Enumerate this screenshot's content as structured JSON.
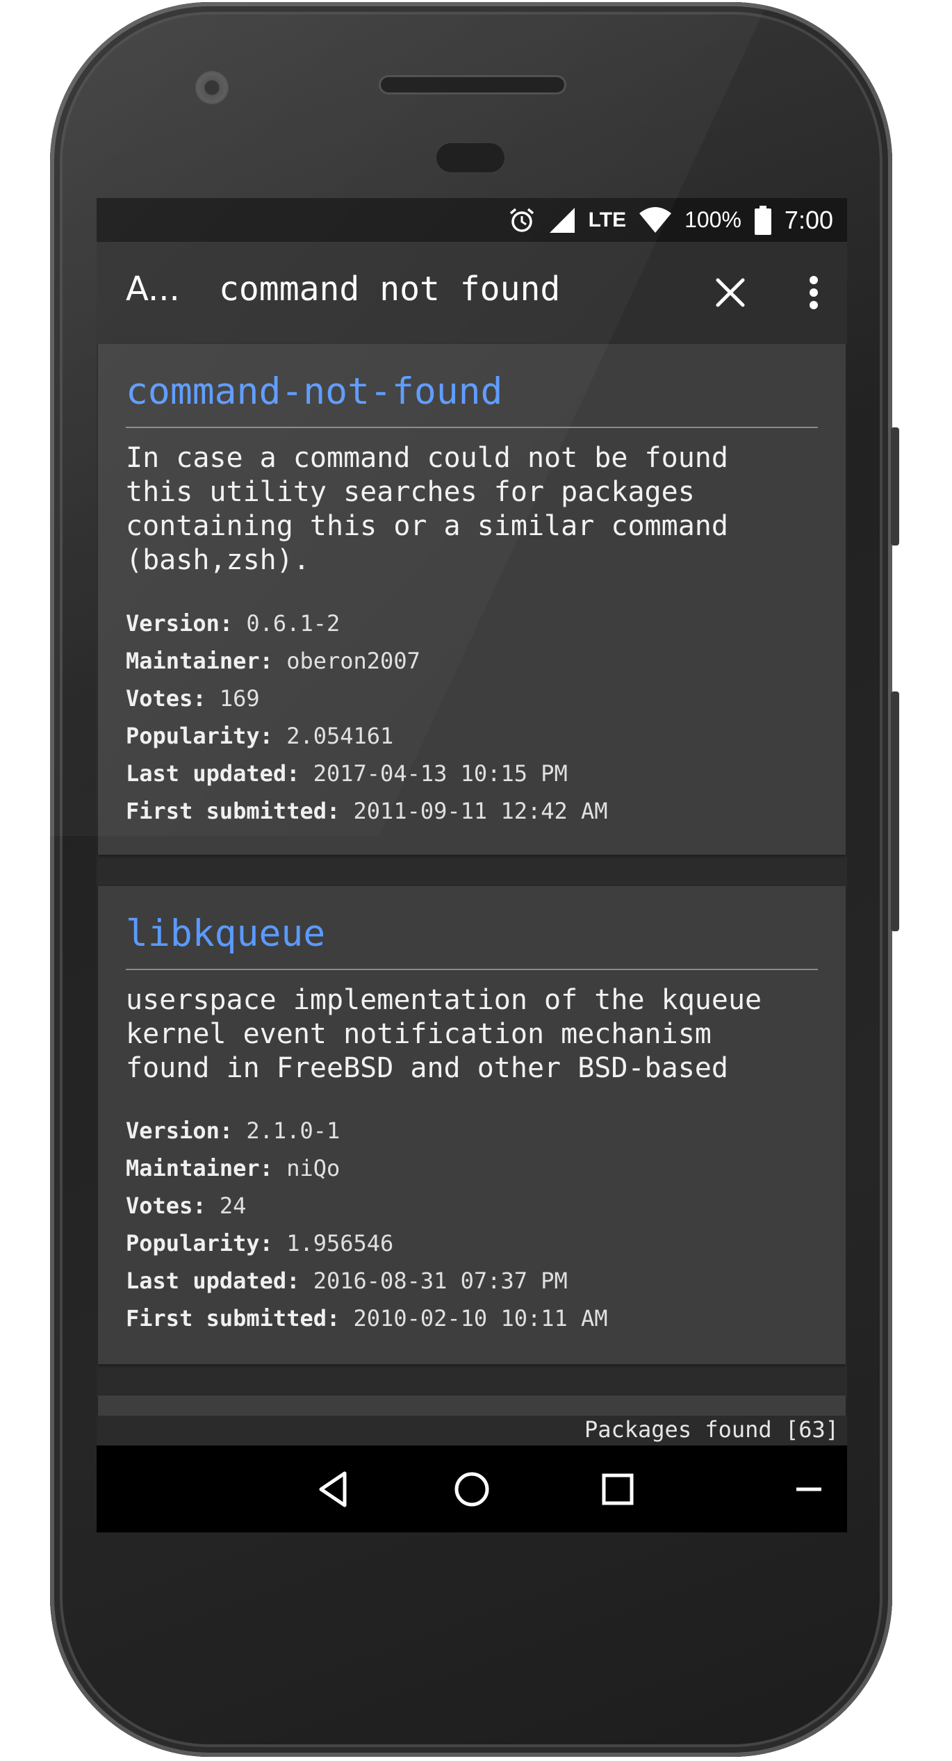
{
  "status_bar": {
    "battery_percent": "100%",
    "time": "7:00",
    "network": "LTE",
    "icons": [
      "alarm-icon",
      "signal-icon",
      "wifi-icon",
      "battery-icon"
    ]
  },
  "toolbar": {
    "title": "A...",
    "search_query": "command not found",
    "close_icon": "close-icon",
    "menu_icon": "more-vert-icon"
  },
  "labels": {
    "version": "Version:",
    "maintainer": "Maintainer:",
    "votes": "Votes:",
    "popularity": "Popularity:",
    "last_updated": "Last updated:",
    "first_submitted": "First submitted:"
  },
  "packages": [
    {
      "name": "command-not-found",
      "description": "In case a command could not be found\nthis utility searches for packages\ncontaining this or a similar command\n(bash,zsh).",
      "version": "0.6.1-2",
      "maintainer": "oberon2007",
      "votes": "169",
      "popularity": "2.054161",
      "last_updated": "2017-04-13 10:15 PM",
      "first_submitted": "2011-09-11 12:42 AM"
    },
    {
      "name": "libkqueue",
      "description": "userspace implementation of the kqueue\nkernel event notification mechanism\nfound in FreeBSD and other BSD-based",
      "version": "2.1.0-1",
      "maintainer": "niQo",
      "votes": "24",
      "popularity": "1.956546",
      "last_updated": "2016-08-31 07:37 PM",
      "first_submitted": "2010-02-10 10:11 AM"
    }
  ],
  "footer": {
    "packages_found": "Packages found [63]"
  },
  "nav_bar": {
    "buttons": [
      "back-icon",
      "home-icon",
      "recents-icon",
      "minimize-icon"
    ]
  },
  "colors": {
    "accent": "#5b9aff",
    "card": "#3e3e3e",
    "background": "#2b2b2b"
  }
}
